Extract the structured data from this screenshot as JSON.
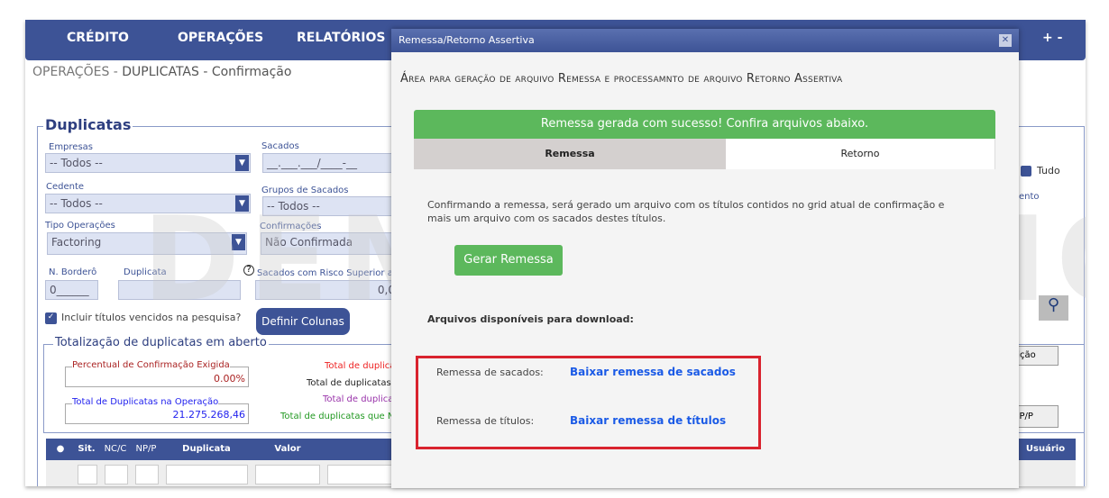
{
  "nav": {
    "items": [
      "CRÉDITO",
      "OPERAÇÕES",
      "RELATÓRIOS"
    ],
    "zoom": "+ -"
  },
  "breadcrumb": {
    "part1": "OPERAÇÕES - ",
    "part2": "DUPLICATAS",
    "part3": " - Confirmação"
  },
  "form": {
    "legend": "Duplicatas",
    "empresas": {
      "label": "Empresas",
      "value": "-- Todos --"
    },
    "sacados": {
      "label": "Sacados",
      "value": "__.___.___/____-__"
    },
    "cedente": {
      "label": "Cedente",
      "value": "-- Todos --"
    },
    "grupos": {
      "label": "Grupos de Sacados",
      "value": "-- Todos --"
    },
    "tipo": {
      "label": "Tipo Operações",
      "value": "Factoring"
    },
    "confirmacoes": {
      "label": "Confirmações",
      "value": "Não Confirmada"
    },
    "bordero": {
      "label": "N. Borderô",
      "value": "0______"
    },
    "duplicata": {
      "label": "Duplicata",
      "value": ""
    },
    "risco": {
      "label": "Sacados com Risco Superior a",
      "value": "0,0"
    },
    "incluir": {
      "label": "Incluir títulos vencidos na pesquisa?",
      "checked": true
    },
    "definir": "Definir Colunas",
    "tudo": "Tudo",
    "partial_link": "ento",
    "posicao": "sição",
    "npp_btn": "NP/P"
  },
  "totals": {
    "legend": "Totalização de duplicatas em aberto",
    "percentual": {
      "label": "Percentual de Confirmação Exigida",
      "value": "0.00%"
    },
    "total_op": {
      "label": "Total de Duplicatas na Operação",
      "value": "21.275.268,46"
    },
    "lines": [
      "Total de duplica",
      "Total de duplicatas",
      "Total de duplica",
      "Total de duplicatas que N"
    ]
  },
  "grid": {
    "columns": [
      "Sit.",
      "NC/C",
      "NP/P",
      "Duplicata",
      "Valor",
      "Usuário"
    ]
  },
  "watermark": "DEMO VERSION",
  "modal": {
    "title": "Remessa/Retorno Assertiva",
    "heading": "Área para geração de arquivo Remessa e processamnto de arquivo Retorno Assertiva",
    "alert": "Remessa gerada com sucesso! Confira arquivos abaixo.",
    "tabs": [
      "Remessa",
      "Retorno"
    ],
    "description": "Confirmando a remessa, será gerado um arquivo com os títulos contidos no grid atual de confirmação e mais um arquivo com os sacados destes títulos.",
    "generate": "Gerar Remessa",
    "files_title": "Arquivos disponíveis para download:",
    "files": [
      {
        "label": "Remessa de sacados:",
        "link": "Baixar remessa de sacados"
      },
      {
        "label": "Remessa de títulos:",
        "link": "Baixar remessa de títulos"
      }
    ]
  }
}
